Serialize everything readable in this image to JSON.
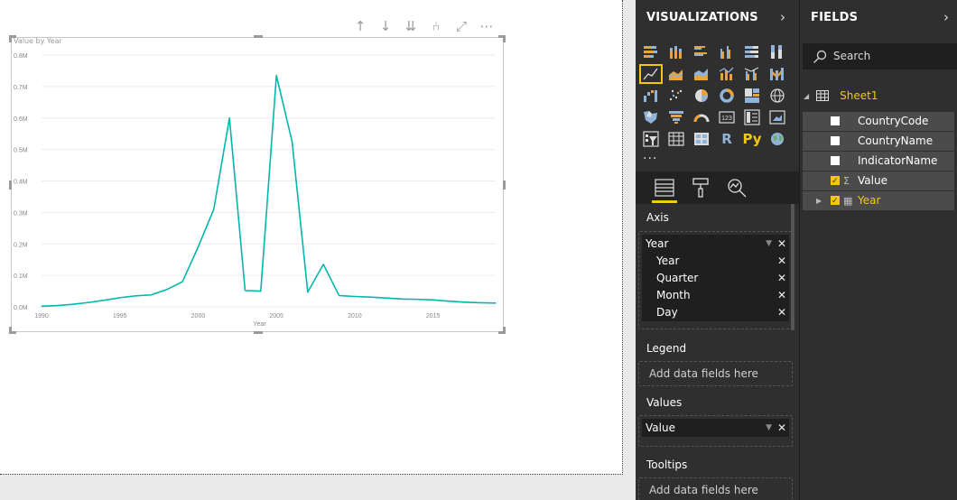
{
  "visual_header_icons": [
    "arrow-up-icon",
    "arrow-down-icon",
    "double-arrow-down-icon",
    "hierarchy-expand-icon",
    "focus-mode-icon",
    "more-options-icon"
  ],
  "chart_data": {
    "type": "line",
    "title": "Value by Year",
    "xlabel": "Year",
    "ylabel": "",
    "x": [
      1990,
      1991,
      1992,
      1993,
      1994,
      1995,
      1996,
      1997,
      1998,
      1999,
      2000,
      2001,
      2002,
      2003,
      2004,
      2005,
      2006,
      2007,
      2008,
      2009,
      2010,
      2011,
      2012,
      2013,
      2014,
      2015,
      2016,
      2017,
      2018,
      2019
    ],
    "series": [
      {
        "values": [
          0.002,
          0.004,
          0.008,
          0.014,
          0.021,
          0.029,
          0.035,
          0.038,
          0.055,
          0.08,
          0.19,
          0.31,
          0.6,
          0.052,
          0.05,
          0.735,
          0.525,
          0.047,
          0.135,
          0.036,
          0.033,
          0.031,
          0.028,
          0.025,
          0.024,
          0.022,
          0.018,
          0.015,
          0.013,
          0.012
        ],
        "color": "#01b8aa"
      }
    ],
    "xticks": [
      "1990",
      "1995",
      "2000",
      "2005",
      "2010",
      "2015"
    ],
    "yticks": [
      "0.0M",
      "0.1M",
      "0.2M",
      "0.3M",
      "0.4M",
      "0.5M",
      "0.6M",
      "0.7M",
      "0.8M"
    ],
    "xlim": [
      1990,
      2019
    ],
    "ylim": [
      0,
      0.8
    ],
    "grid": true
  },
  "visualizations": {
    "title": "VISUALIZATIONS",
    "icons": [
      "stacked-bar-icon",
      "stacked-column-icon",
      "clustered-bar-icon",
      "clustered-column-icon",
      "100-stacked-bar-icon",
      "100-stacked-column-icon",
      "line-chart-icon",
      "area-chart-icon",
      "stacked-area-icon",
      "line-column-icon",
      "line-clustered-column-icon",
      "ribbon-chart-icon",
      "waterfall-icon",
      "scatter-icon",
      "pie-icon",
      "donut-icon",
      "treemap-icon",
      "map-icon",
      "filled-map-icon",
      "funnel-icon",
      "gauge-icon",
      "card-icon",
      "multirow-card-icon",
      "kpi-icon",
      "slicer-icon",
      "table-icon",
      "matrix-icon",
      "r-visual-icon",
      "python-visual-icon",
      "globe-icon"
    ],
    "selected_index": 6,
    "more": "···",
    "tabs": [
      "fields-tab-icon",
      "format-tab-icon",
      "analytics-tab-icon"
    ],
    "axis": {
      "label": "Axis",
      "field": "Year",
      "hierarchy": [
        "Year",
        "Quarter",
        "Month",
        "Day"
      ]
    },
    "legend": {
      "label": "Legend",
      "placeholder": "Add data fields here"
    },
    "values": {
      "label": "Values",
      "field": "Value"
    },
    "tooltips": {
      "label": "Tooltips",
      "placeholder": "Add data fields here"
    }
  },
  "fields": {
    "title": "FIELDS",
    "search_placeholder": "Search",
    "table": "Sheet1",
    "items": [
      {
        "name": "CountryCode",
        "checked": false,
        "icon": ""
      },
      {
        "name": "CountryName",
        "checked": false,
        "icon": ""
      },
      {
        "name": "IndicatorName",
        "checked": false,
        "icon": ""
      },
      {
        "name": "Value",
        "checked": true,
        "icon": "sigma-icon"
      },
      {
        "name": "Year",
        "checked": true,
        "icon": "calendar-hierarchy-icon"
      }
    ]
  },
  "colors": {
    "accent": "#f2c811",
    "line": "#01b8aa",
    "pane": "#2f2f2f"
  }
}
